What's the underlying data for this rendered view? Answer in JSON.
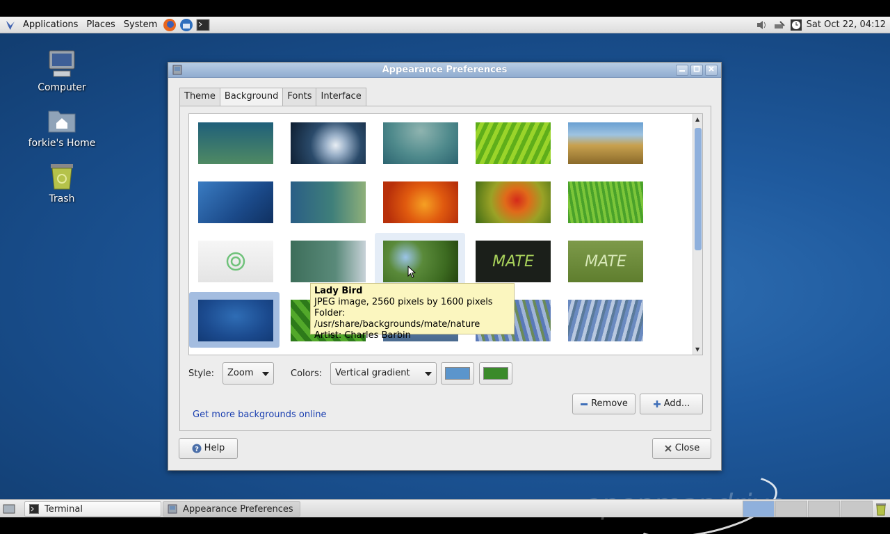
{
  "top_panel": {
    "menus": [
      "Applications",
      "Places",
      "System"
    ],
    "launchers": [
      "firefox-icon",
      "thunderbird-icon",
      "terminal-icon"
    ],
    "clock": "Sat Oct 22, 04:12"
  },
  "desktop": {
    "icons": [
      {
        "label": "Computer",
        "icon": "computer-icon"
      },
      {
        "label": "forkie's Home",
        "icon": "home-folder-icon"
      },
      {
        "label": "Trash",
        "icon": "trash-icon"
      }
    ]
  },
  "window": {
    "title": "Appearance Preferences",
    "tabs": [
      "Theme",
      "Background",
      "Fonts",
      "Interface"
    ],
    "active_tab": "Background",
    "tooltip": {
      "name": "Lady Bird",
      "line1": "JPEG image, 2560 pixels by 1600 pixels",
      "line2": "Folder: /usr/share/backgrounds/mate/nature",
      "line3": "Artist: Charles Barbin"
    },
    "style_label": "Style:",
    "style_value": "Zoom",
    "colors_label": "Colors:",
    "colors_value": "Vertical gradient",
    "primary_color": "#5b95cc",
    "secondary_color": "#3a8a2a",
    "more_link": "Get more backgrounds online",
    "remove_label": "Remove",
    "add_label": "Add...",
    "help_label": "Help",
    "close_label": "Close"
  },
  "taskbar": {
    "tasks": [
      "Terminal",
      "Appearance Preferences"
    ]
  },
  "thumbnails": {
    "mate_text_1": "MATE",
    "mate_text_2": "MATE"
  }
}
